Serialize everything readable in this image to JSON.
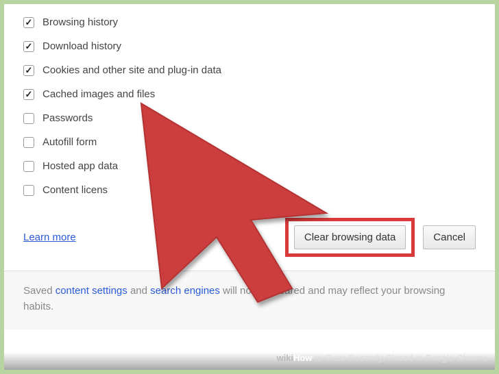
{
  "options": [
    {
      "label": "Browsing history",
      "checked": true
    },
    {
      "label": "Download history",
      "checked": true
    },
    {
      "label": "Cookies and other site and plug-in data",
      "checked": true
    },
    {
      "label": "Cached images and files",
      "checked": true
    },
    {
      "label": "Passwords",
      "checked": false
    },
    {
      "label": "Autofill form",
      "checked": false
    },
    {
      "label": "Hosted app data",
      "checked": false
    },
    {
      "label": "Content licens",
      "checked": false
    }
  ],
  "learn_more": "Learn more",
  "buttons": {
    "clear": "Clear browsing data",
    "cancel": "Cancel"
  },
  "footer": {
    "pre": "Saved ",
    "link1": "content settings",
    "mid": " and ",
    "link2": "search engines",
    "post": " will not be cleared and may reflect your browsing habits."
  },
  "caption": {
    "brand": "wikiHow",
    "title": " to Clear Recently Closed in Google Chrome"
  },
  "colors": {
    "highlight": "#d93a3a",
    "arrow": "#cc3e3e",
    "link": "#2a5bd7"
  }
}
